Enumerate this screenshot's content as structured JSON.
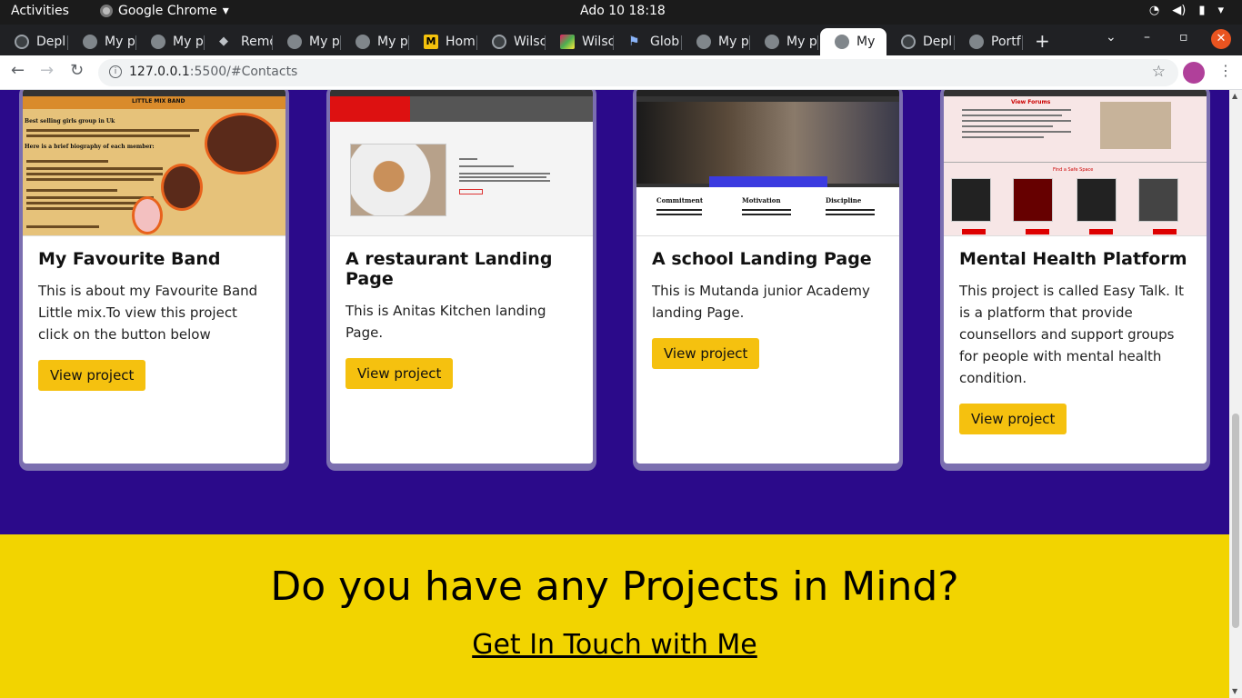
{
  "system_bar": {
    "activities": "Activities",
    "app_name": "Google Chrome",
    "clock": "Ado 10  18:18"
  },
  "tabs": [
    {
      "label": "Depl",
      "icon": "github-icon"
    },
    {
      "label": "My p",
      "icon": "globe-icon"
    },
    {
      "label": "My p",
      "icon": "globe-icon"
    },
    {
      "label": "Remo",
      "icon": "layers-icon"
    },
    {
      "label": "My p",
      "icon": "globe-icon"
    },
    {
      "label": "My p",
      "icon": "globe-icon"
    },
    {
      "label": "Hom",
      "icon": "m-icon"
    },
    {
      "label": "Wilsc",
      "icon": "github-icon"
    },
    {
      "label": "Wilsc",
      "icon": "pixel-icon"
    },
    {
      "label": "Glob",
      "icon": "flag-icon"
    },
    {
      "label": "My p",
      "icon": "globe-icon"
    },
    {
      "label": "My p",
      "icon": "globe-icon"
    },
    {
      "label": "My",
      "icon": "globe-icon",
      "active": true
    },
    {
      "label": "Depl",
      "icon": "github-icon"
    },
    {
      "label": "Portf",
      "icon": "globe-icon"
    }
  ],
  "address_bar": {
    "host": "127.0.0.1",
    "path": ":5500/#Contacts"
  },
  "projects": [
    {
      "title": "My Favourite Band",
      "description": "This is about my Favourite Band Little mix.To view this project click on the button below",
      "button": "View project",
      "thumb": {
        "header": "LITTLE MIX BAND",
        "heading": "Best selling girls group in Uk",
        "sub": "Here is a brief biography of each member:"
      }
    },
    {
      "title": "A restaurant Landing Page",
      "description": "This is Anitas Kitchen landing Page.",
      "button": "View project",
      "thumb": {}
    },
    {
      "title": "A school Landing Page",
      "description": "This is Mutanda junior Academy landing Page.",
      "button": "View project",
      "thumb": {
        "cols": [
          "Commitment",
          "Motivation",
          "Discipline"
        ]
      }
    },
    {
      "title": "Mental Health Platform",
      "description": "This project is called Easy Talk. It is a platform that provide counsellors and support groups for people with mental health condition.",
      "button": "View project",
      "thumb": {
        "title": "View Forums",
        "sub": "Find a Safe Space"
      }
    }
  ],
  "cta": {
    "heading": "Do you have any Projects in Mind?",
    "link": "Get In Touch with Me"
  }
}
